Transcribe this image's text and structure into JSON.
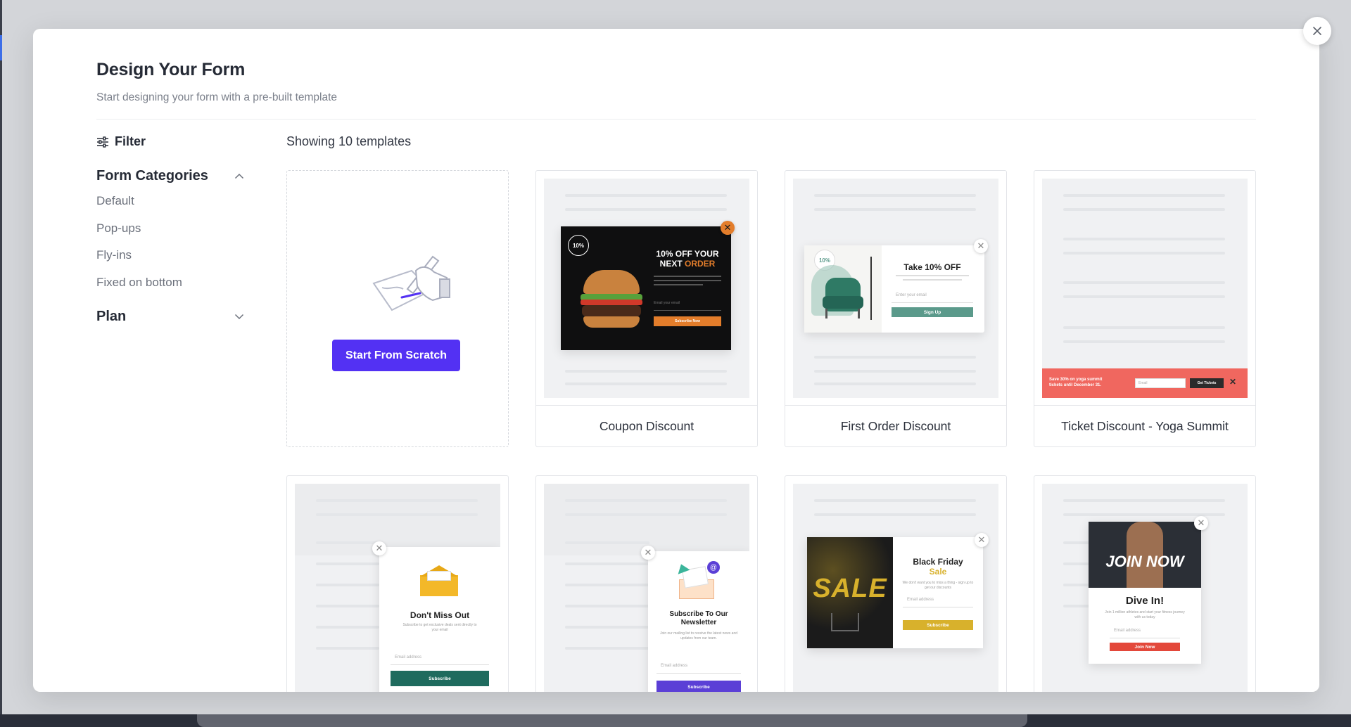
{
  "modal": {
    "title": "Design Your Form",
    "subtitle": "Start designing your form with a pre-built template",
    "close_icon": "close-icon"
  },
  "sidebar": {
    "filter_label": "Filter",
    "form_categories": {
      "label": "Form Categories",
      "expanded": true,
      "items": [
        "Default",
        "Pop-ups",
        "Fly-ins",
        "Fixed on bottom"
      ]
    },
    "plan": {
      "label": "Plan",
      "expanded": false
    }
  },
  "main": {
    "showing_text": "Showing 10 templates",
    "scratch_button": "Start From Scratch",
    "cards": [
      {
        "label": "Coupon Discount"
      },
      {
        "label": "First Order Discount"
      },
      {
        "label": "Ticket Discount - Yoga Summit"
      }
    ],
    "previews": {
      "coupon": {
        "heading_1": "10% OFF YOUR",
        "heading_2": "NEXT ",
        "heading_accent": "ORDER",
        "badge": "10%",
        "button": "Subscribe Now",
        "field": "Email your email"
      },
      "first_order": {
        "heading": "Take 10% OFF",
        "badge": "10%",
        "field": "Enter your email",
        "button": "Sign Up"
      },
      "yoga": {
        "text_1": "Save 30% on yoga summit",
        "text_2": "tickets until December 31.",
        "field": "Email",
        "button": "Get Tickets"
      },
      "dont_miss": {
        "heading": "Don't Miss Out",
        "text": "Subscribe to get exclusive deals sent directly to your email",
        "field": "Email address",
        "button": "Subscribe"
      },
      "newsletter": {
        "heading": "Subscribe To Our Newsletter",
        "text": "Join our mailing list to receive the latest news and updates from our team.",
        "field": "Email address",
        "button": "Subscribe"
      },
      "black_friday": {
        "sale": "SALE",
        "heading": "Black Friday",
        "heading_accent": "Sale",
        "text": "We don't want you to miss a thing - sign up to get our discounts",
        "field": "Email address",
        "button": "Subscribe"
      },
      "join_now": {
        "banner": "JOIN NOW",
        "heading": "Dive In!",
        "text": "Join 1 million athletes and start your fitness journey with us today",
        "field": "Email address",
        "button": "Join Now"
      }
    }
  },
  "colors": {
    "primary": "#5331f3",
    "teal": "#5b9a8b",
    "coral": "#f0675f",
    "dark_green": "#1f6b5e",
    "orange": "#e37d2b",
    "gold": "#d8b12c",
    "red": "#e3483a"
  }
}
